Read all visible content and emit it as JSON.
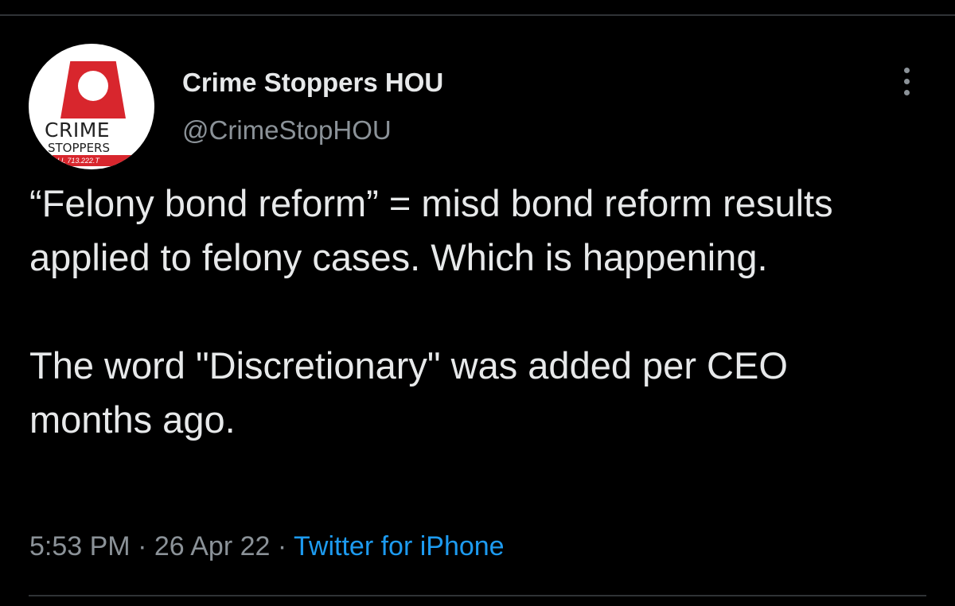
{
  "tweet": {
    "author": {
      "display_name": "Crime Stoppers HOU",
      "handle": "@CrimeStopHOU",
      "avatar_text": {
        "line1": "CRIME",
        "line2": "STOPPERS",
        "phone": "LL 713.222.T"
      }
    },
    "body": {
      "paragraph1": "“Felony bond reform” = misd bond reform results applied to felony cases. Which is happening.",
      "paragraph2": "The word \"Discretionary\" was added per CEO months ago."
    },
    "meta": {
      "time": "5:53 PM",
      "separator": " · ",
      "date": "26 Apr 22",
      "source": "Twitter for iPhone"
    }
  },
  "icons": {
    "more": "more-options-icon"
  },
  "colors": {
    "background": "#000000",
    "primary_text": "#e7e9ea",
    "secondary_text": "#8b9298",
    "link": "#1d9bf0",
    "logo_red": "#d8262d",
    "divider": "#2f3336"
  }
}
